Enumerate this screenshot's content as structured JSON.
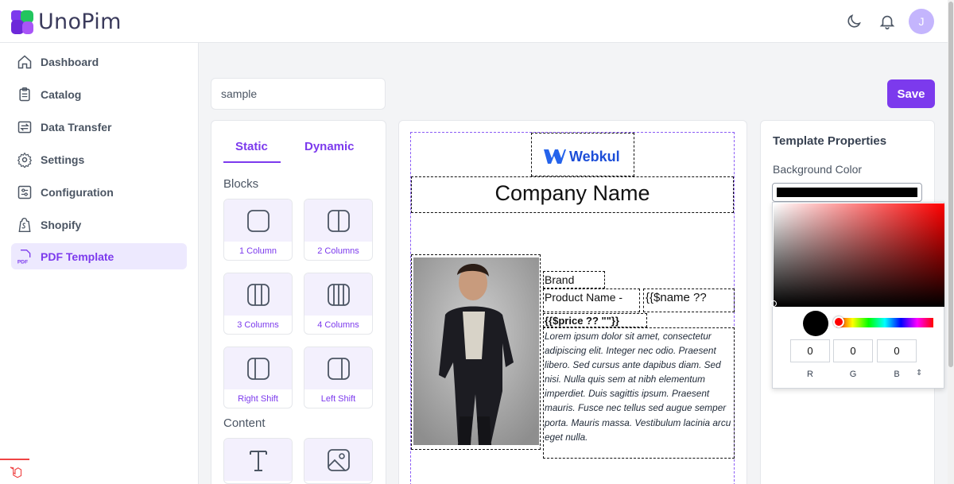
{
  "app": {
    "name": "UnoPim",
    "brand_color": "#7c3aed"
  },
  "header": {
    "avatar_initial": "J",
    "icons": [
      "moon-icon",
      "bell-icon"
    ]
  },
  "sidebar": {
    "items": [
      {
        "label": "Dashboard",
        "icon": "home-icon"
      },
      {
        "label": "Catalog",
        "icon": "clipboard-icon"
      },
      {
        "label": "Data Transfer",
        "icon": "transfer-icon"
      },
      {
        "label": "Settings",
        "icon": "gear-icon"
      },
      {
        "label": "Configuration",
        "icon": "sliders-icon"
      },
      {
        "label": "Shopify",
        "icon": "shopify-icon"
      },
      {
        "label": "PDF Template",
        "icon": "pdf-icon",
        "active": true
      }
    ]
  },
  "template_name": {
    "value": "sample"
  },
  "toolbar": {
    "save_label": "Save"
  },
  "blocks_panel": {
    "tabs": [
      {
        "label": "Static",
        "active": true
      },
      {
        "label": "Dynamic"
      }
    ],
    "blocks_title": "Blocks",
    "blocks": [
      "1 Column",
      "2 Columns",
      "3 Columns",
      "4 Columns",
      "Right Shift",
      "Left Shift"
    ],
    "content_title": "Content",
    "content_items": [
      "text-icon",
      "image-icon"
    ]
  },
  "canvas": {
    "logo_text": "Webkul",
    "company_name": "Company Name",
    "brand_label": "Brand",
    "product_name_label": "Product Name -",
    "name_placeholder": "{{$name ??",
    "price_placeholder": "{{$price ?? \"\"}}",
    "description": "Lorem ipsum dolor sit amet, consectetur adipiscing elit. Integer nec odio. Praesent libero. Sed cursus ante dapibus diam. Sed nisi. Nulla quis sem at nibh elementum imperdiet. Duis sagittis ipsum. Praesent mauris. Fusce nec tellus sed augue semper porta. Mauris massa. Vestibulum lacinia arcu eget nulla."
  },
  "properties": {
    "title": "Template Properties",
    "background_label": "Background Color",
    "background_color": "#000000",
    "rgb": {
      "r": "0",
      "g": "0",
      "b": "0"
    },
    "labels": {
      "r": "R",
      "g": "G",
      "b": "B"
    }
  }
}
